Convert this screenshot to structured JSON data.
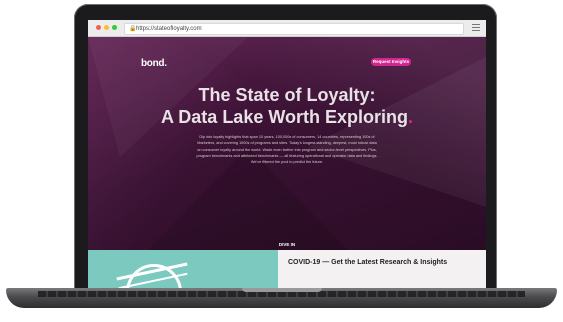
{
  "browser": {
    "url": "https://stateofloyalty.com"
  },
  "header": {
    "logo": "bond.",
    "cta_label": "Request Insights"
  },
  "hero": {
    "title_line1": "The State of Loyalty:",
    "title_line2": "A Data Lake Worth Exploring",
    "title_dot": ".",
    "intro": "Dip into loyalty highlights that span 10 years, 100,000s of consumers, 14 countries, representing 100s of Marketers, and covering 1000s of programs and sites. Today's longest-standing, deepest, most robust data on consumer loyalty around the world. Wade even farther into program and sector-level perspectives. Plus, program benchmarks and attributed benchmarks — all featuring operational and operator data and findings. We've filtered the pool to predict the future.",
    "dive_label": "DIVE IN",
    "dive_chevron": "⌄"
  },
  "covid": {
    "title": "COVID-19 — Get the Latest Research & Insights"
  },
  "colors": {
    "accent": "#d1258f",
    "hero_bg": "#3a1233",
    "teal": "#7cc9c0"
  }
}
